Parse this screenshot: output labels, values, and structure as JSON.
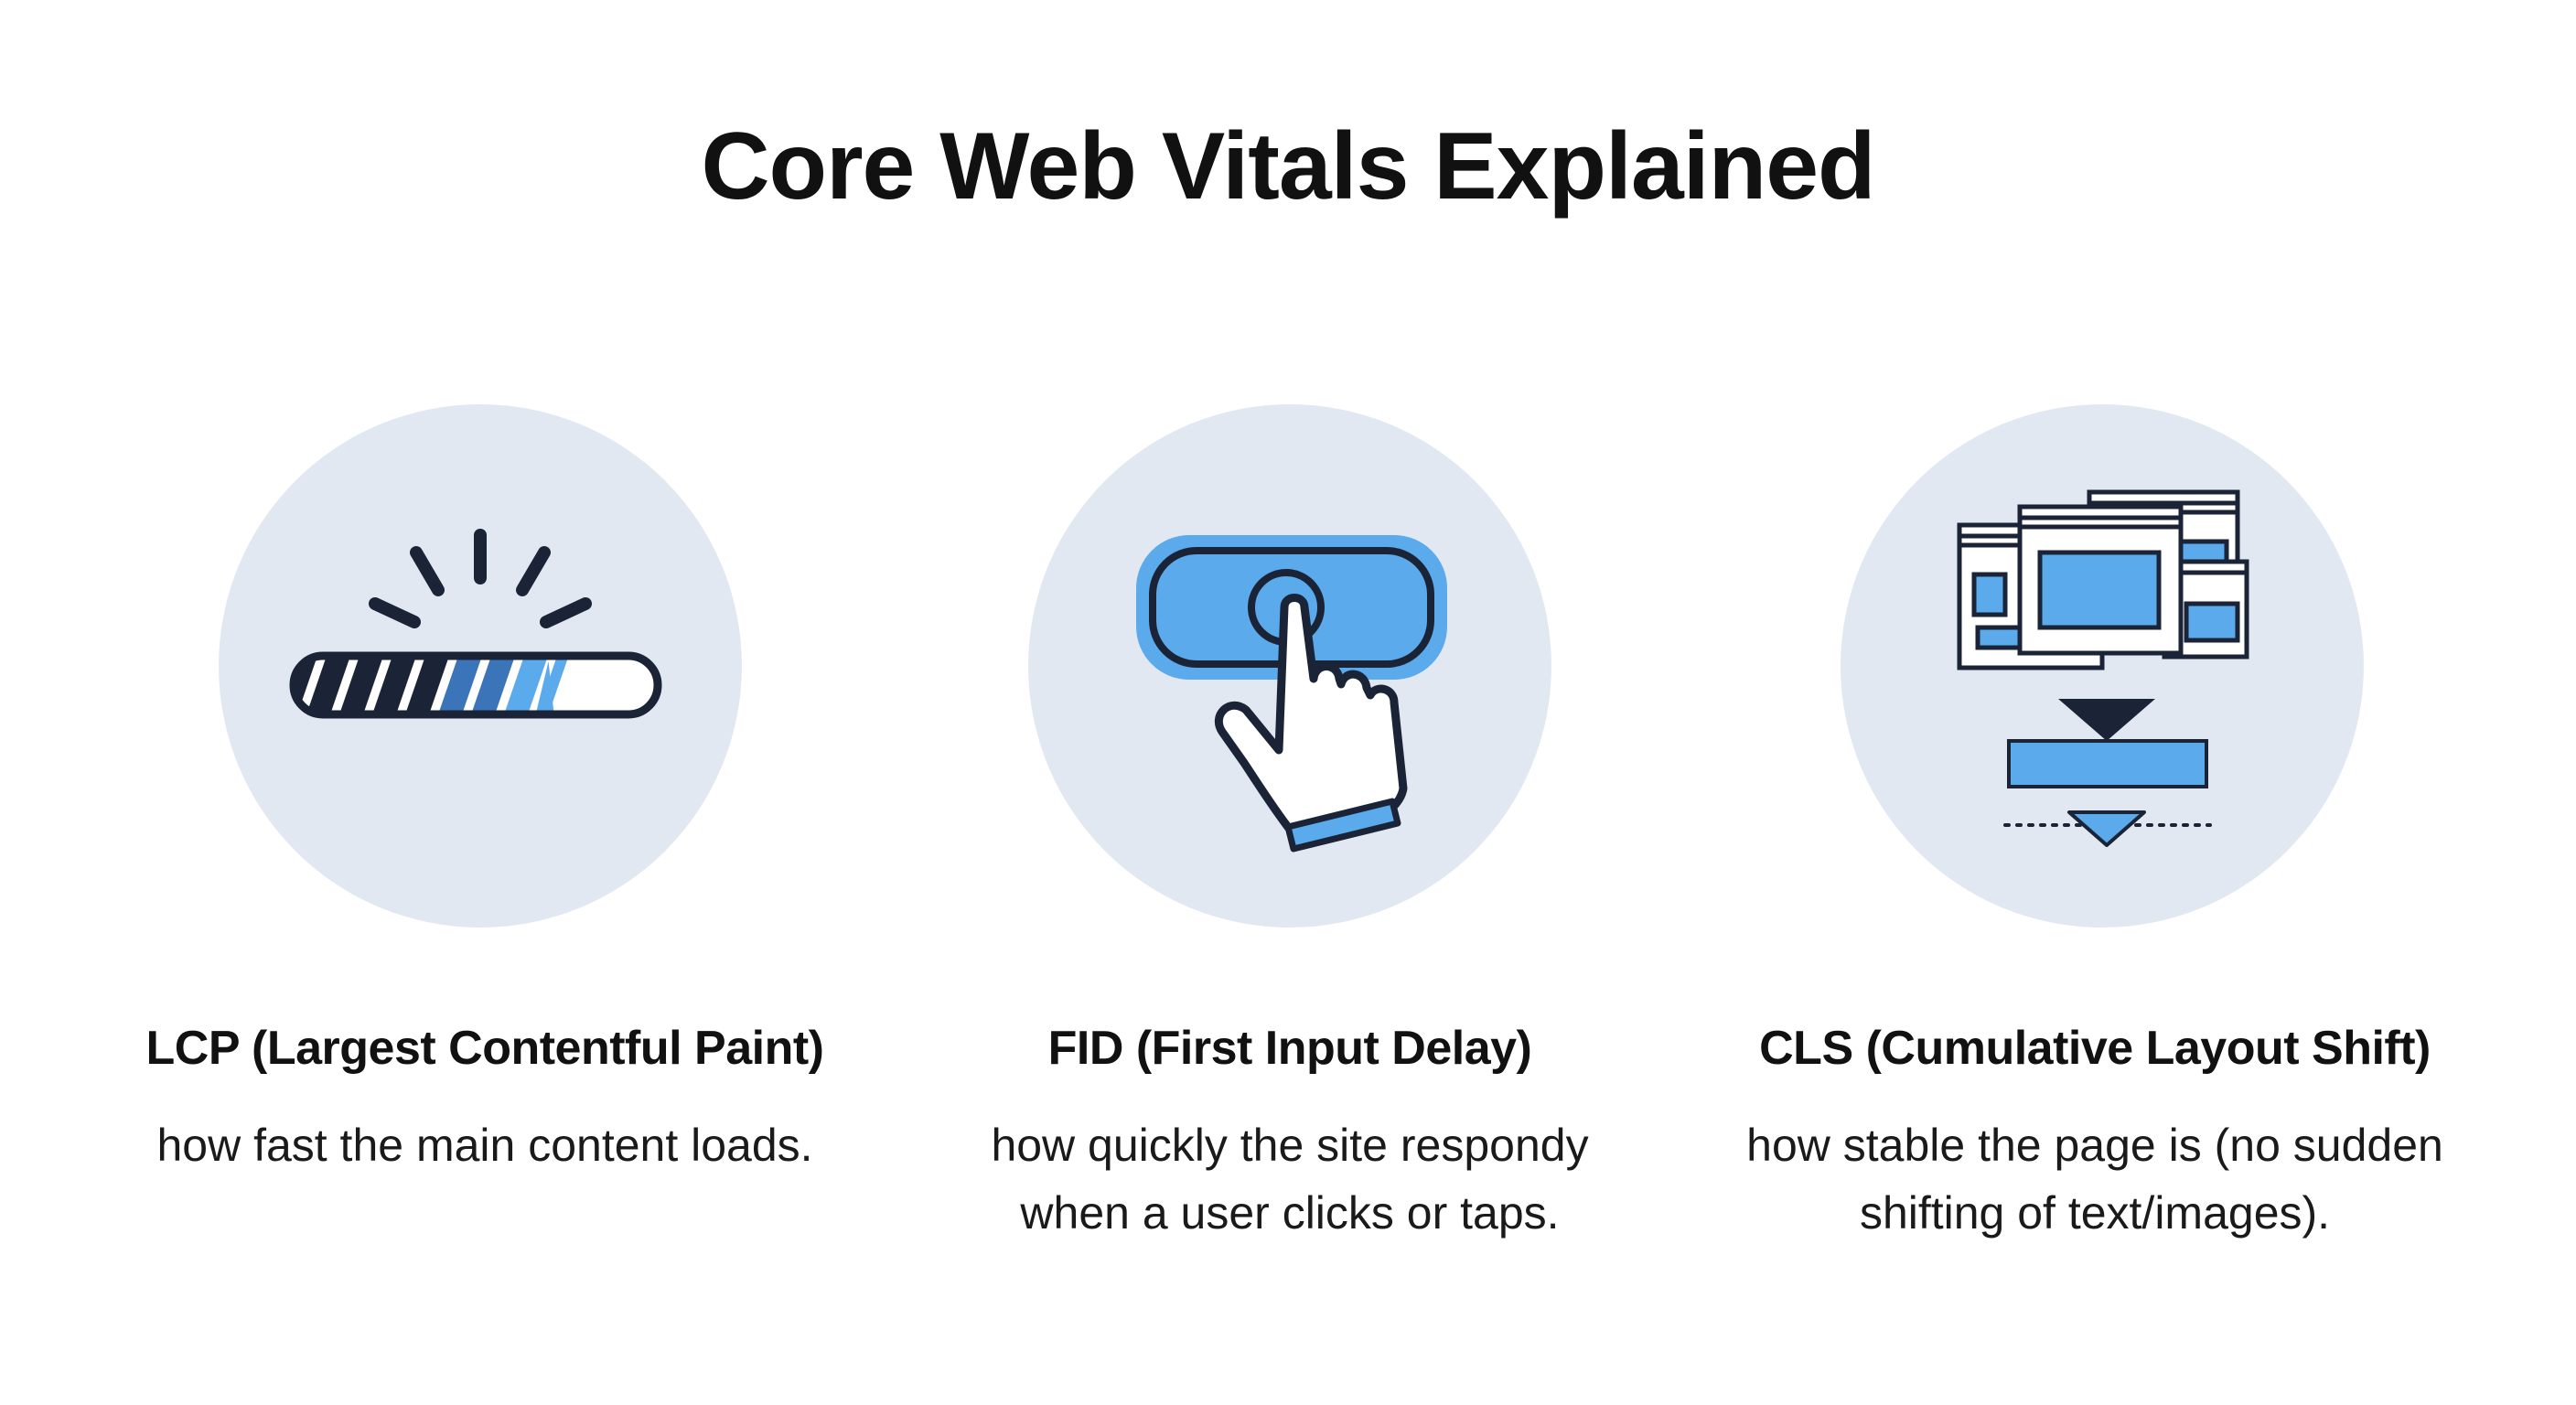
{
  "title": "Core Web Vitals Explained",
  "colors": {
    "circle_bg": "#e2e8f2",
    "dark": "#1b2437",
    "accent_blue": "#5aaaec",
    "mid_blue": "#3b74b8",
    "white": "#ffffff"
  },
  "metrics": [
    {
      "icon": "loading-bar-icon",
      "heading": "LCP (Largest Contentful Paint)",
      "desc_lines": [
        "how fast the main content loads."
      ],
      "progress": 0.7
    },
    {
      "icon": "pointer-hand-click-icon",
      "heading": "FID (First Input Delay)",
      "desc_lines": [
        "how quickly the site respondy",
        "when a user clicks or taps."
      ]
    },
    {
      "icon": "layout-shift-icon",
      "heading": "CLS (Cumulative Layout Shift)",
      "desc_lines": [
        "how stable the page is (no sudden",
        "shifting of text/images)."
      ]
    }
  ]
}
